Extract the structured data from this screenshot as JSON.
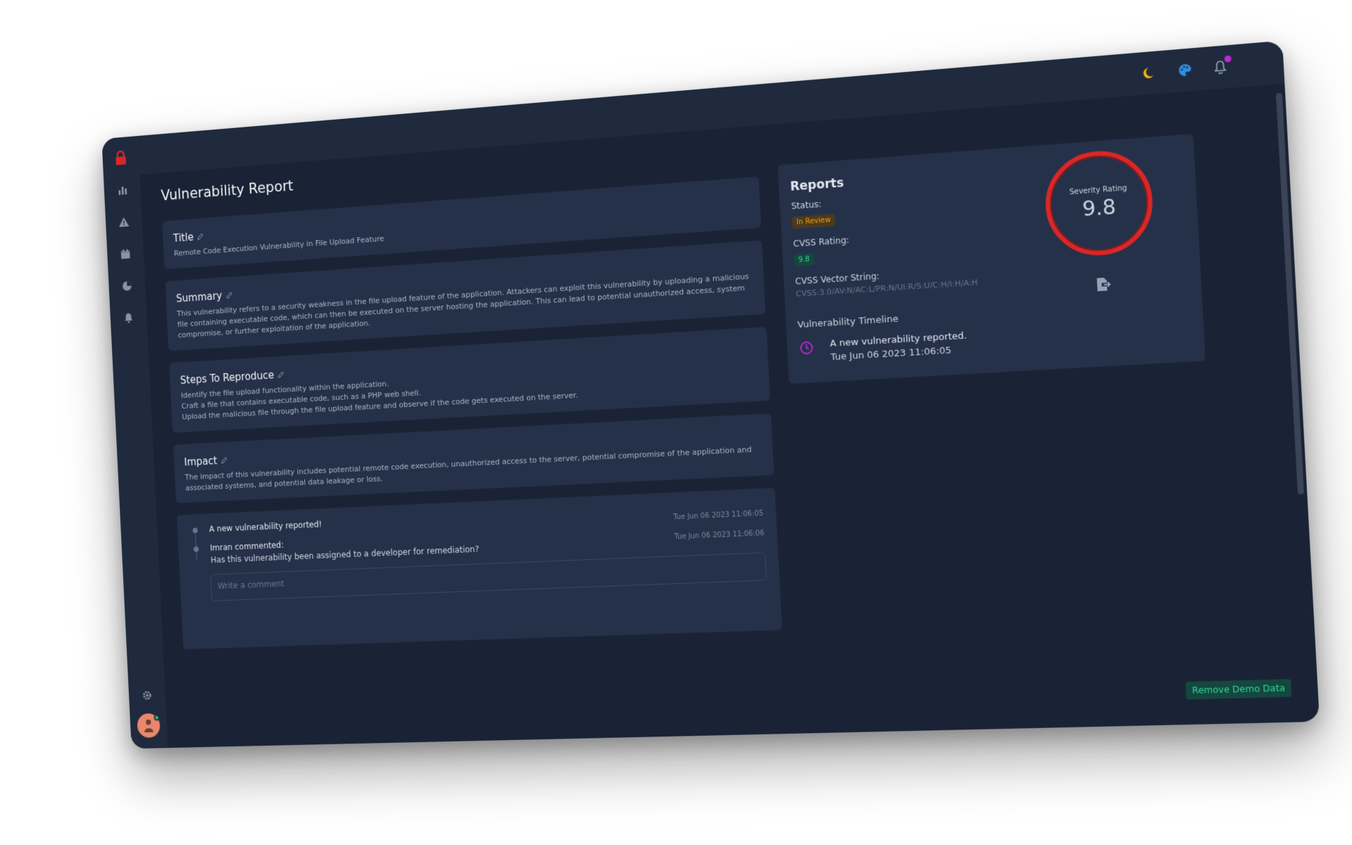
{
  "page": {
    "title": "Vulnerability Report"
  },
  "sidebar": {
    "icons": [
      "lock-icon",
      "bar-chart-icon",
      "warning-icon",
      "calendar-icon",
      "pie-chart-icon",
      "bell-icon"
    ],
    "bottom_icons": [
      "settings-icon",
      "avatar"
    ]
  },
  "topbar": {
    "icons": [
      "moon-icon",
      "palette-icon",
      "bell-icon"
    ]
  },
  "cards": {
    "title": {
      "heading": "Title",
      "body": "Remote Code Execution Vulnerability in File Upload Feature"
    },
    "summary": {
      "heading": "Summary",
      "body": "This vulnerability refers to a security weakness in the file upload feature of the application. Attackers can exploit this vulnerability by uploading a malicious file containing executable code, which can then be executed on the server hosting the application. This can lead to potential unauthorized access, system compromise, or further exploitation of the application."
    },
    "steps": {
      "heading": "Steps To Reproduce",
      "lines": [
        "Identify the file upload functionality within the application.",
        "Craft a file that contains executable code, such as a PHP web shell.",
        "Upload the malicious file through the file upload feature and observe if the code gets executed on the server."
      ]
    },
    "impact": {
      "heading": "Impact",
      "body": "The impact of this vulnerability includes potential remote code execution, unauthorized access to the server, potential compromise of the application and associated systems, and potential data leakage or loss."
    }
  },
  "activity": {
    "items": [
      {
        "text": "A new vulnerability reported!",
        "time": "Tue Jun 06 2023 11:06:05"
      },
      {
        "text": "Imran commented:",
        "sub": "Has this vulnerability been assigned to a developer for remediation?",
        "time": "Tue Jun 06 2023 11:06:06"
      }
    ],
    "comment_placeholder": "Write a comment"
  },
  "reports": {
    "title": "Reports",
    "status_label": "Status:",
    "status_value": "In Review",
    "cvss_label": "CVSS Rating:",
    "cvss_value": "9.8",
    "vector_label": "CVSS Vector String:",
    "vector_value": "CVSS:3.0/AV:N/AC:L/PR:N/UI:R/S:U/C:H/I:H/A:H",
    "gauge_label": "Severity Rating",
    "gauge_value": "9.8",
    "timeline_title": "Vulnerability Timeline",
    "timeline_text": "A new vulnerability reported.",
    "timeline_time": "Tue Jun 06 2023 11:06:05"
  },
  "remove_button": "Remove Demo Data",
  "colors": {
    "bg": "#1a2335",
    "card": "#253149",
    "accent_red": "#dc2626",
    "accent_green": "#34d399",
    "accent_amber": "#f59e0b",
    "accent_purple": "#c026d3"
  }
}
